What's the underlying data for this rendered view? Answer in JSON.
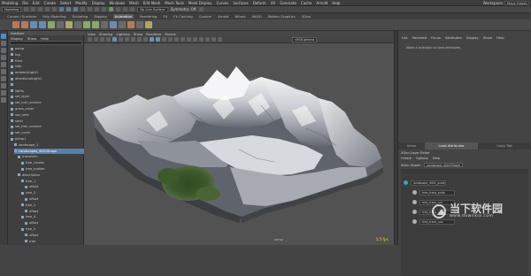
{
  "menubar": {
    "items": [
      "Modeling",
      "File",
      "Edit",
      "Create",
      "Select",
      "Modify",
      "Display",
      "Windows",
      "Mesh",
      "Edit Mesh",
      "Mesh Tools",
      "Mesh Display",
      "Curves",
      "Surfaces",
      "Deform",
      "UV",
      "Generate",
      "Cache",
      "Arnold",
      "Help"
    ],
    "workspace_label": "Workspace:",
    "workspace_value": "Maya Classic"
  },
  "statusline": {
    "mode": "Modeling",
    "no_live_surface": "No Live Surface",
    "symmetry": "Symmetry: Off"
  },
  "shelf": {
    "tabs": [
      "Curves / Surfaces",
      "Poly Modeling",
      "Sculpting",
      "Rigging",
      "Animation",
      "Rendering",
      "FX",
      "FX Caching",
      "Custom",
      "Arnold",
      "Bifrost",
      "MASH",
      "Motion Graphics",
      "XGen"
    ],
    "active_tab": 4
  },
  "outliner": {
    "title": "Outliner",
    "menu": [
      "Display",
      "Show",
      "Help"
    ],
    "items": [
      {
        "label": "persp",
        "indent": 0,
        "selected": false
      },
      {
        "label": "top",
        "indent": 0,
        "selected": false
      },
      {
        "label": "front",
        "indent": 0,
        "selected": false
      },
      {
        "label": "side",
        "indent": 0,
        "selected": false
      },
      {
        "label": "ambientLight1",
        "indent": 0,
        "selected": false
      },
      {
        "label": "directionalLight1",
        "indent": 0,
        "selected": false
      },
      {
        "label": "",
        "indent": 0,
        "selected": false
      },
      {
        "label": "lights",
        "indent": 0,
        "selected": false
      },
      {
        "label": "set_layer",
        "indent": 0,
        "selected": false
      },
      {
        "label": "set_mtn_volume",
        "indent": 0,
        "selected": false
      },
      {
        "label": "grass_cover",
        "indent": 0,
        "selected": false
      },
      {
        "label": "sun_sets",
        "indent": 0,
        "selected": false
      },
      {
        "label": "sand",
        "indent": 0,
        "selected": false
      },
      {
        "label": "set_mtn_volume",
        "indent": 0,
        "selected": false
      },
      {
        "label": "set_cover",
        "indent": 0,
        "selected": false
      },
      {
        "label": "persp1",
        "indent": 0,
        "selected": false
      },
      {
        "label": "landscape_1",
        "indent": 1,
        "selected": false
      },
      {
        "label": "Landscapes_4001Shape",
        "indent": 1,
        "selected": true
      },
      {
        "label": "transform",
        "indent": 2,
        "selected": false
      },
      {
        "label": "tree_cluster",
        "indent": 3,
        "selected": false
      },
      {
        "label": "tree_scatter",
        "indent": 3,
        "selected": false
      },
      {
        "label": "description",
        "indent": 2,
        "selected": false
      },
      {
        "label": "tree_1",
        "indent": 3,
        "selected": false
      },
      {
        "label": "offset",
        "indent": 4,
        "selected": false
      },
      {
        "label": "tree_2",
        "indent": 3,
        "selected": false
      },
      {
        "label": "offset",
        "indent": 4,
        "selected": false
      },
      {
        "label": "tree_3",
        "indent": 3,
        "selected": false
      },
      {
        "label": "offset",
        "indent": 4,
        "selected": false
      },
      {
        "label": "tree_4",
        "indent": 3,
        "selected": false
      },
      {
        "label": "offset",
        "indent": 4,
        "selected": false
      },
      {
        "label": "tree_5",
        "indent": 3,
        "selected": false
      },
      {
        "label": "offset",
        "indent": 4,
        "selected": false
      },
      {
        "label": "tree",
        "indent": 4,
        "selected": false
      }
    ]
  },
  "viewport": {
    "menu": [
      "View",
      "Shading",
      "Lighting",
      "Show",
      "Renderer",
      "Panels"
    ],
    "camera": "sRGB gamma",
    "hud_camera": "persp",
    "fps": "5.5 fps"
  },
  "attribute_editor": {
    "menu": [
      "List",
      "Selected",
      "Focus",
      "Attributes",
      "Display",
      "Show",
      "Help"
    ],
    "message": "Make a selection to view attributes",
    "tabs": [
      "Inbox",
      "Load Attributes",
      "Copy Tab"
    ],
    "active_tab": 1
  },
  "xgen": {
    "title": "XGen Layer Editor",
    "menu": [
      "Create",
      "Options",
      "Help"
    ],
    "shape_label": "XGen Shape:",
    "shape_value": "Landscape_4001Shape",
    "rows": [
      {
        "label": "landscape_4001_scale",
        "indent": 0,
        "teal": true
      },
      {
        "label": "tree_trans_scale",
        "indent": 1,
        "teal": false
      },
      {
        "label": "tree_trans_uvf",
        "indent": 1,
        "teal": false
      },
      {
        "label": "tree_trans_uvsf",
        "indent": 1,
        "teal": false
      },
      {
        "label": "tree_trans_uvs",
        "indent": 1,
        "teal": false
      }
    ]
  },
  "watermark": {
    "title": "当下软件园",
    "subtitle": "www.downxia.com"
  },
  "colors": {
    "selection_blue": "#5b7fa6",
    "fps_yellow": "#ffcc33",
    "xgen_teal": "#3aa8b8"
  }
}
